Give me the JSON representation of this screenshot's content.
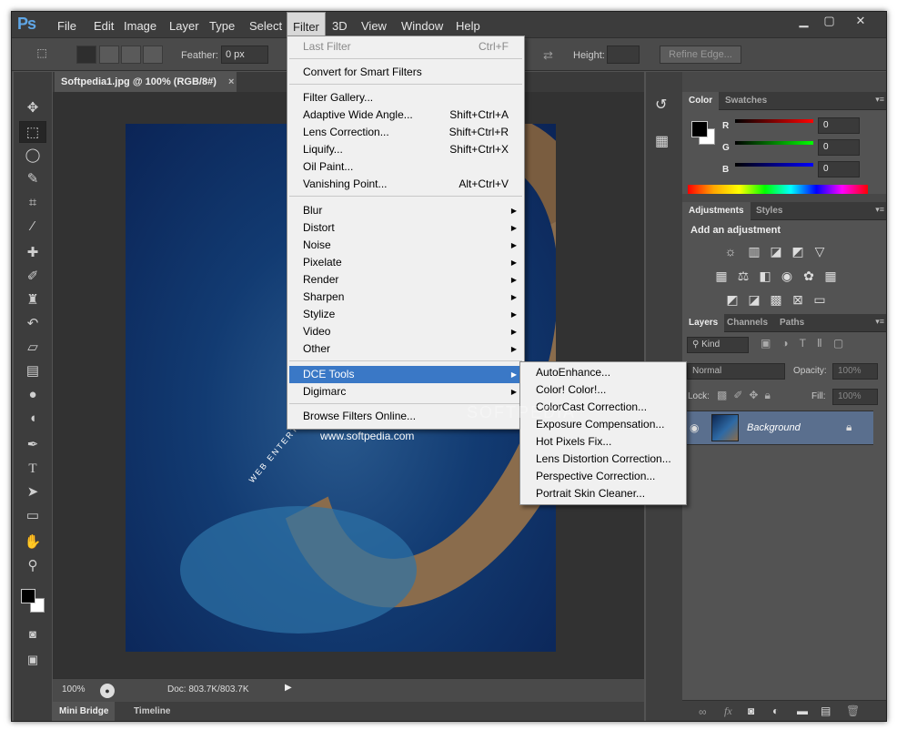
{
  "app": {
    "logo": "Ps"
  },
  "menubar": {
    "items": [
      "File",
      "Edit",
      "Image",
      "Layer",
      "Type",
      "Select",
      "Filter",
      "3D",
      "View",
      "Window",
      "Help"
    ],
    "active": "Filter"
  },
  "window_controls": {
    "minimize": "▁",
    "maximize": "▢",
    "close": "✕"
  },
  "options_bar": {
    "feather_label": "Feather:",
    "feather_value": "0 px",
    "height_label": "Height:",
    "refine_edge": "Refine Edge..."
  },
  "document": {
    "tab_title": "Softpedia1.jpg @ 100% (RGB/8#)",
    "tab_close": "×",
    "watermark_url": "www.softpedia.com",
    "watermark_text": "WEB  ENTERTA",
    "softpedia_mark": "SOFTPEDIA"
  },
  "status_bar": {
    "zoom": "100%",
    "doc_size": "Doc: 803.7K/803.7K"
  },
  "bottom_tabs": {
    "mini_bridge": "Mini Bridge",
    "timeline": "Timeline"
  },
  "filter_menu": {
    "items": [
      {
        "label": "Last Filter",
        "shortcut": "Ctrl+F",
        "disabled": true
      },
      {
        "label": "Convert for Smart Filters",
        "shortcut": ""
      },
      {
        "label": "Filter Gallery...",
        "shortcut": ""
      },
      {
        "label": "Adaptive Wide Angle...",
        "shortcut": "Shift+Ctrl+A"
      },
      {
        "label": "Lens Correction...",
        "shortcut": "Shift+Ctrl+R"
      },
      {
        "label": "Liquify...",
        "shortcut": "Shift+Ctrl+X"
      },
      {
        "label": "Oil Paint...",
        "shortcut": ""
      },
      {
        "label": "Vanishing Point...",
        "shortcut": "Alt+Ctrl+V"
      },
      {
        "label": "Blur",
        "submenu": true
      },
      {
        "label": "Distort",
        "submenu": true
      },
      {
        "label": "Noise",
        "submenu": true
      },
      {
        "label": "Pixelate",
        "submenu": true
      },
      {
        "label": "Render",
        "submenu": true
      },
      {
        "label": "Sharpen",
        "submenu": true
      },
      {
        "label": "Stylize",
        "submenu": true
      },
      {
        "label": "Video",
        "submenu": true
      },
      {
        "label": "Other",
        "submenu": true
      },
      {
        "label": "DCE Tools",
        "submenu": true,
        "highlighted": true
      },
      {
        "label": "Digimarc",
        "submenu": true
      },
      {
        "label": "Browse Filters Online...",
        "shortcut": ""
      }
    ]
  },
  "dce_submenu": {
    "items": [
      "AutoEnhance...",
      "Color! Color!...",
      "ColorCast Correction...",
      "Exposure Compensation...",
      "Hot Pixels Fix...",
      "Lens Distortion Correction...",
      "Perspective Correction...",
      "Portrait Skin Cleaner..."
    ]
  },
  "color_panel": {
    "tabs": [
      "Color",
      "Swatches"
    ],
    "r_label": "R",
    "g_label": "G",
    "b_label": "B",
    "r_value": "0",
    "g_value": "0",
    "b_value": "0"
  },
  "adjustments_panel": {
    "tabs": [
      "Adjustments",
      "Styles"
    ],
    "heading": "Add an adjustment"
  },
  "layers_panel": {
    "tabs": [
      "Layers",
      "Channels",
      "Paths"
    ],
    "kind_filter": "Kind",
    "blend_mode": "Normal",
    "opacity_label": "Opacity:",
    "opacity_value": "100%",
    "lock_label": "Lock:",
    "fill_label": "Fill:",
    "fill_value": "100%",
    "layer_name": "Background"
  },
  "colors": {
    "accent": "#3a78c6",
    "menu_bg": "#f0f0f0",
    "ui_dark": "#535353"
  }
}
